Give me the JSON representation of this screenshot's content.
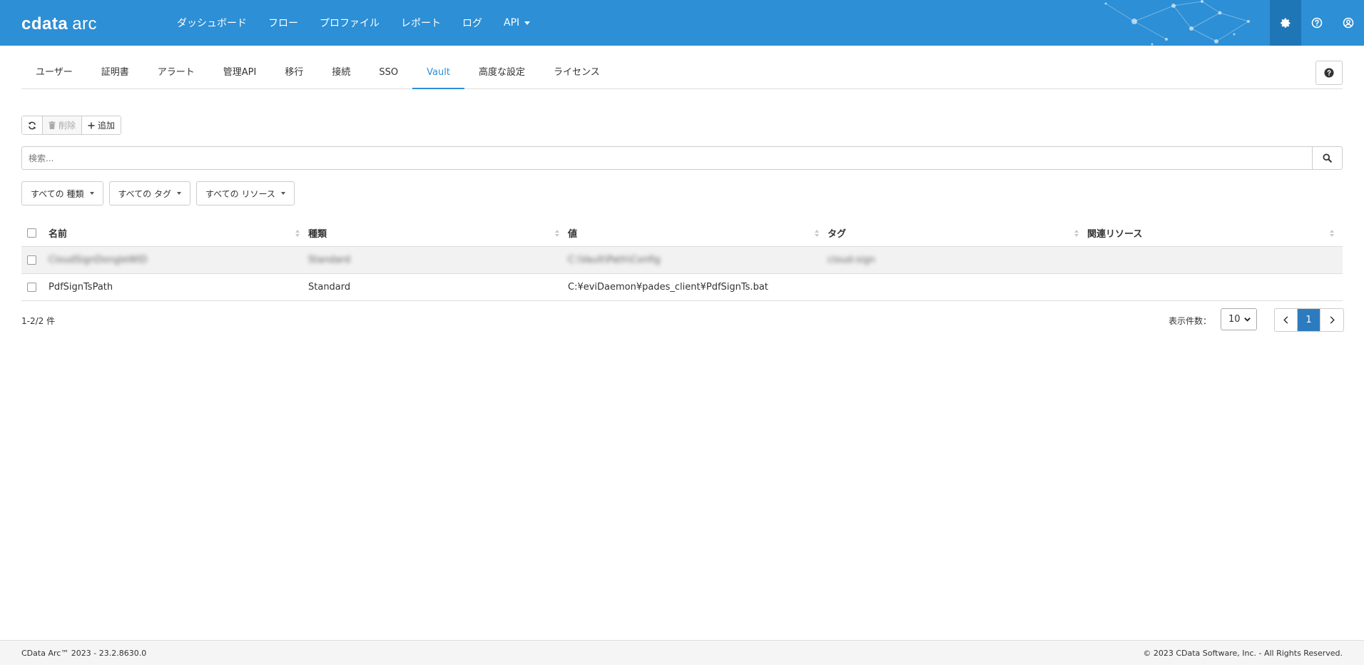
{
  "app": {
    "logo_main": "cdata",
    "logo_sub": "arc"
  },
  "nav": {
    "items": [
      {
        "label": "ダッシュボード"
      },
      {
        "label": "フロー"
      },
      {
        "label": "プロファイル"
      },
      {
        "label": "レポート"
      },
      {
        "label": "ログ"
      },
      {
        "label": "API"
      }
    ]
  },
  "tabs": [
    {
      "label": "ユーザー"
    },
    {
      "label": "証明書"
    },
    {
      "label": "アラート"
    },
    {
      "label": "管理API"
    },
    {
      "label": "移行"
    },
    {
      "label": "接続"
    },
    {
      "label": "SSO"
    },
    {
      "label": "Vault",
      "active": true
    },
    {
      "label": "高度な設定"
    },
    {
      "label": "ライセンス"
    }
  ],
  "toolbar": {
    "delete_label": "削除",
    "add_label": "追加"
  },
  "search": {
    "placeholder": "検索..."
  },
  "filters": {
    "type": "すべての 種類",
    "tag": "すべての タグ",
    "resource": "すべての リソース"
  },
  "table": {
    "headers": {
      "name": "名前",
      "type": "種類",
      "value": "値",
      "tag": "タグ",
      "resource": "関連リソース"
    },
    "rows": [
      {
        "name": "CloudSignDongleWID",
        "type": "Standard",
        "value": "C:\\Vault\\Path\\Config",
        "tag": "cloud-sign",
        "resource": "",
        "blurred": true
      },
      {
        "name": "PdfSignTsPath",
        "type": "Standard",
        "value": "C:¥eviDaemon¥pades_client¥PdfSignTs.bat",
        "tag": "",
        "resource": "",
        "blurred": false
      }
    ]
  },
  "pagination": {
    "count_text": "1-2/2 件",
    "per_page_label": "表示件数：",
    "per_page_value": "10",
    "current_page": "1"
  },
  "footer": {
    "left": "CData Arc™ 2023 - 23.2.8630.0",
    "right": "© 2023 CData Software, Inc. - All Rights Reserved."
  },
  "colors": {
    "primary": "#2d8fd5",
    "active_page": "#2d7bbf"
  },
  "icons": {
    "top": [
      "gear-icon",
      "help-circle-icon",
      "user-circle-icon"
    ],
    "toolbar": [
      "refresh-icon",
      "trash-icon",
      "plus-icon"
    ],
    "search": "search-icon"
  }
}
